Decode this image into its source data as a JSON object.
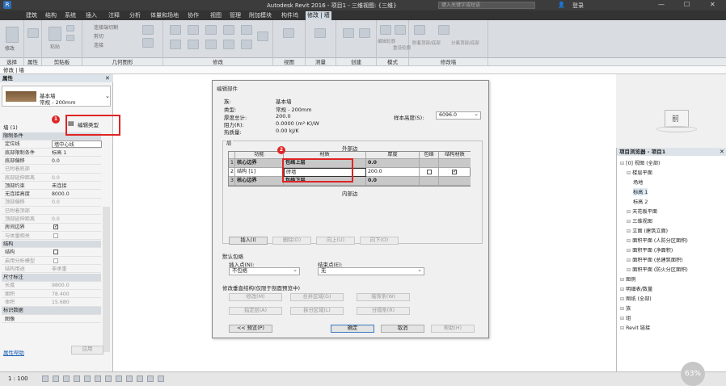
{
  "titlebar": {
    "title": "Autodesk Revit 2016 -    项目1 - 三维视图: {三维}",
    "search_placeholder": "键入关键字或短语",
    "login": "登录"
  },
  "menu_tabs": [
    "建筑",
    "结构",
    "系统",
    "插入",
    "注释",
    "分析",
    "体量和场地",
    "协作",
    "视图",
    "管理",
    "附加模块",
    "构件坞",
    "修改 | 墙"
  ],
  "active_menu_tab": "修改 | 墙",
  "ribbon_groups": [
    "选择",
    "属性",
    "剪贴板",
    "几何图形",
    "修改",
    "视图",
    "测量",
    "创建",
    "模式",
    "修改墙"
  ],
  "ribbon_small": {
    "modify": "修改",
    "paste": "粘贴",
    "connect": "连接端切割",
    "cut": "剪切",
    "join": "连接",
    "edit_profile": "编辑轮廓",
    "reset_profile": "重设轮廓",
    "attach": "附着顶部/底部",
    "detach": "分离顶部/底部"
  },
  "contextbar": "修改 | 墙",
  "properties": {
    "header": "属性",
    "type_family": "基本墙",
    "type_name": "常规 - 200mm",
    "instance_label": "墙 (1)",
    "edit_type_button": "编辑类型",
    "help_link": "属性帮助",
    "apply_button": "应用",
    "rows": [
      {
        "k": "限制条件",
        "v": "",
        "sec": true
      },
      {
        "k": "定位线",
        "v": "墙中心线"
      },
      {
        "k": "底部限制条件",
        "v": "标高 1"
      },
      {
        "k": "底部偏移",
        "v": "0.0"
      },
      {
        "k": "已附着底部",
        "v": "",
        "dim": true
      },
      {
        "k": "底部延伸距离",
        "v": "0.0",
        "dim": true
      },
      {
        "k": "顶部约束",
        "v": "未连接"
      },
      {
        "k": "无连接高度",
        "v": "8000.0"
      },
      {
        "k": "顶部偏移",
        "v": "0.0",
        "dim": true
      },
      {
        "k": "已附着顶部",
        "v": "",
        "dim": true
      },
      {
        "k": "顶部延伸距离",
        "v": "0.0",
        "dim": true
      },
      {
        "k": "房间边界",
        "v": "",
        "check": "on"
      },
      {
        "k": "与体量相关",
        "v": "",
        "dim": true,
        "check": "dim"
      },
      {
        "k": "结构",
        "v": "",
        "sec": true
      },
      {
        "k": "结构",
        "v": "",
        "check": "off"
      },
      {
        "k": "启用分析模型",
        "v": "",
        "dim": true,
        "check": "dim"
      },
      {
        "k": "结构用途",
        "v": "非承重",
        "dim": true
      },
      {
        "k": "尺寸标注",
        "v": "",
        "sec": true
      },
      {
        "k": "长度",
        "v": "9800.0",
        "dim": true
      },
      {
        "k": "面积",
        "v": "78.400",
        "dim": true
      },
      {
        "k": "体积",
        "v": "15.680",
        "dim": true
      },
      {
        "k": "标识数据",
        "v": "",
        "sec": true
      },
      {
        "k": "图像",
        "v": ""
      }
    ]
  },
  "dialog": {
    "title": "编辑部件",
    "family_label": "族:",
    "family_value": "基本墙",
    "type_label": "类型:",
    "type_value": "常规 - 200mm",
    "thickness_label": "厚度总计:",
    "thickness_value": "200.0",
    "resistance_label": "阻力(R):",
    "resistance_value": "0.0000 (m²·K)/W",
    "thermal_label": "热质量:",
    "thermal_value": "0.00 kJ/K",
    "sample_height_label": "样本高度(S):",
    "sample_height_value": "6096.0",
    "layers_label": "层",
    "exterior_label": "外部边",
    "interior_label": "内部边",
    "columns": [
      "",
      "功能",
      "材质",
      "厚度",
      "包络",
      "结构材质"
    ],
    "layers": [
      {
        "n": "1",
        "func": "核心边界",
        "mat": "包络上层",
        "thick": "0.0",
        "grey": true
      },
      {
        "n": "2",
        "func": "结构 [1]",
        "mat": "砖墙",
        "thick": "200.0",
        "grey": false
      },
      {
        "n": "3",
        "func": "核心边界",
        "mat": "包络下层",
        "thick": "0.0",
        "grey": true
      }
    ],
    "buttons_layers": [
      "插入(I)",
      "删除(D)",
      "向上(U)",
      "向下(O)"
    ],
    "default_wrap_label": "默认包络",
    "insert_at_label": "插入点(N):",
    "insert_at_value": "不包络",
    "end_at_label": "结束点(E):",
    "end_at_value": "无",
    "vertical_label": "修改垂直结构(仅限于剖面预览中)",
    "vertical_buttons": [
      "修改(M)",
      "合并区域(G)",
      "墙饰条(W)",
      "指定层(A)",
      "拆分区域(L)",
      "分隔条(R)"
    ],
    "preview_button": "<< 预览(P)",
    "ok_button": "确定",
    "cancel_button": "取消",
    "help_button": "帮助(H)"
  },
  "annotations": {
    "badge1": "1",
    "badge2": "2"
  },
  "browser": {
    "header": "项目浏览器 - 项目1",
    "items": [
      {
        "label": "[0] 视图 (全部)",
        "indent": 0
      },
      {
        "label": "楼层平面",
        "indent": 1
      },
      {
        "label": "场地",
        "indent": 2
      },
      {
        "label": "标高 1",
        "indent": 2,
        "hl": true
      },
      {
        "label": "标高 2",
        "indent": 2
      },
      {
        "label": "天花板平面",
        "indent": 1
      },
      {
        "label": "三维视图",
        "indent": 1
      },
      {
        "label": "立面 (建筑立面)",
        "indent": 1
      },
      {
        "label": "面积平面 (人防分区面积)",
        "indent": 1
      },
      {
        "label": "面积平面 (净面积)",
        "indent": 1
      },
      {
        "label": "面积平面 (总建筑面积)",
        "indent": 1
      },
      {
        "label": "面积平面 (防火分区面积)",
        "indent": 1
      },
      {
        "label": "图例",
        "indent": 0
      },
      {
        "label": "明细表/数量",
        "indent": 0
      },
      {
        "label": "图纸 (全部)",
        "indent": 0
      },
      {
        "label": "族",
        "indent": 0
      },
      {
        "label": "组",
        "indent": 0
      },
      {
        "label": "Revit 链接",
        "indent": 0
      }
    ]
  },
  "viewcube_label": "前",
  "status": {
    "scale": "1 : 100",
    "percent": "63%"
  }
}
